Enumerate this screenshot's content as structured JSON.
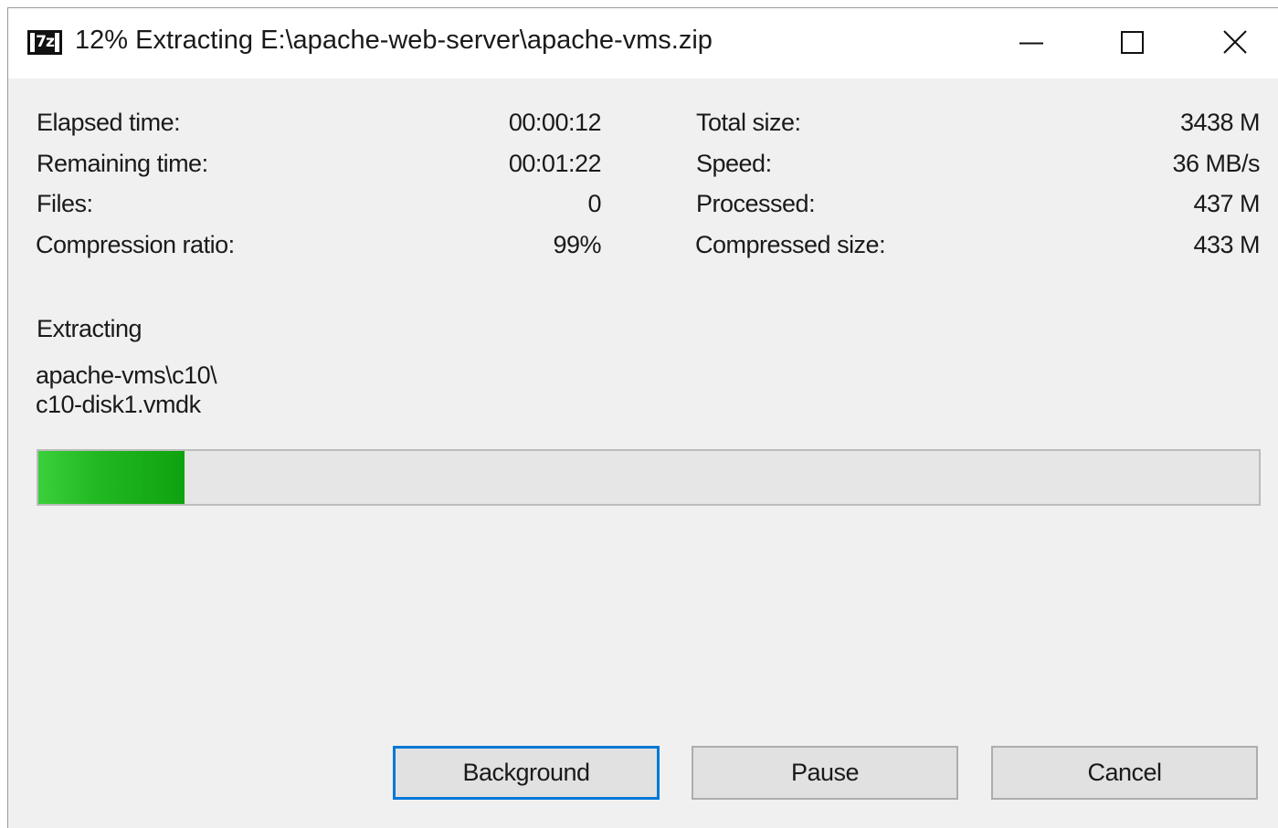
{
  "window": {
    "title": "12% Extracting E:\\apache-web-server\\apache-vms.zip",
    "app_icon_text": "7z",
    "controls": {
      "minimize_icon": "minimize-icon",
      "maximize_icon": "maximize-icon",
      "close_icon": "close-icon"
    }
  },
  "stats": {
    "elapsed_time_label": "Elapsed time:",
    "elapsed_time_value": "00:00:12",
    "remaining_time_label": "Remaining time:",
    "remaining_time_value": "00:01:22",
    "files_label": "Files:",
    "files_value": "0",
    "compression_ratio_label": "Compression ratio:",
    "compression_ratio_value": "99%",
    "total_size_label": "Total size:",
    "total_size_value": "3438 M",
    "speed_label": "Speed:",
    "speed_value": "36 MB/s",
    "processed_label": "Processed:",
    "processed_value": "437 M",
    "compressed_size_label": "Compressed size:",
    "compressed_size_value": "433 M"
  },
  "operation": {
    "label": "Extracting",
    "current_file_line1": "apache-vms\\c10\\",
    "current_file_line2": "c10-disk1.vmdk"
  },
  "progress": {
    "fraction": 0.12,
    "color": "#22b822"
  },
  "buttons": {
    "background_label": "Background",
    "pause_label": "Pause",
    "cancel_label": "Cancel"
  },
  "colors": {
    "focus_border": "#0078d7"
  }
}
